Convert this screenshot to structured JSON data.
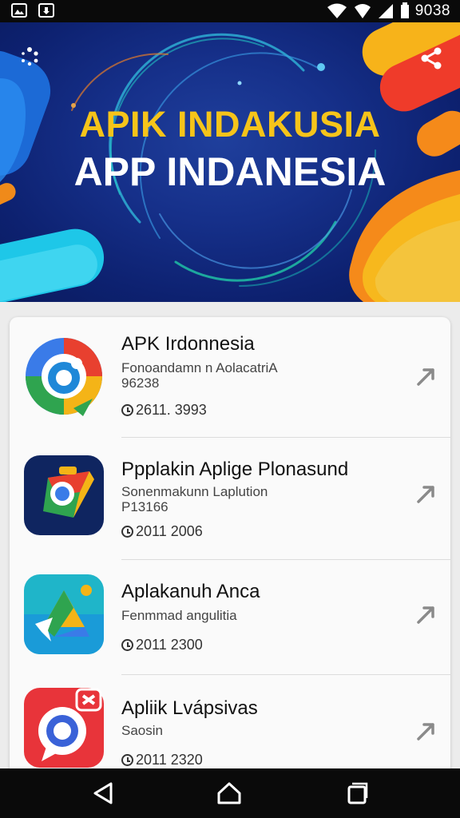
{
  "status_bar": {
    "time": "9038"
  },
  "hero": {
    "title_line1": "APIK INDAKUSIA",
    "title_line2": "APP INDANESIA",
    "colors": {
      "title_line1": "#f6c41a",
      "background": "#16308a"
    }
  },
  "apps": [
    {
      "title": "APK Irdonnesia",
      "subtitle": "Fonoandamn n AolacatriA",
      "code": "96238",
      "date": "2611. 3993",
      "icon": "circular-arrow-app-icon"
    },
    {
      "title": "Ppplakin Aplige Plonasund",
      "subtitle": "Sonenmakunn Laplution",
      "code": "P13166",
      "date": "2011  2006",
      "icon": "map-app-icon"
    },
    {
      "title": "Aplakanuh Anca",
      "subtitle": "Fenmmad angulitia",
      "code": "",
      "date": "2011  2300",
      "icon": "drive-triangle-app-icon"
    },
    {
      "title": "Apliik Lvápsivas",
      "subtitle": "Saosin",
      "code": "",
      "date": "2011  2320",
      "icon": "chat-lens-app-icon"
    }
  ],
  "nav_bar": {
    "buttons": [
      "back-icon",
      "home-icon",
      "recent-apps-icon"
    ]
  }
}
